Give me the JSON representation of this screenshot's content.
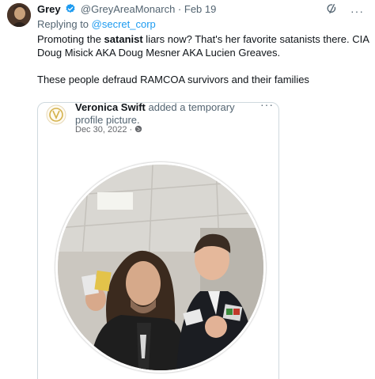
{
  "tweet": {
    "author": {
      "display_name": "Grey",
      "handle": "@GreyAreaMonarch",
      "separator": "·",
      "date": "Feb 19"
    },
    "reply": {
      "prefix": "Replying to ",
      "mention": "@secret_corp"
    },
    "body": {
      "line1_start": "Promoting the ",
      "line1_bold": "satanist",
      "line1_end": " liars now? That's her favorite satanists there. CIA Doug Misick AKA Doug Mesner AKA Lucien Greaves.",
      "paragraph2": "These people defraud RAMCOA survivors and their families"
    },
    "icons": {
      "verified": "verified-badge-icon",
      "grok": "grok-icon",
      "more": "more-icon"
    },
    "more_label": "···"
  },
  "quoted_post": {
    "name": "Veronica Swift",
    "action": " added a temporary profile picture.",
    "date": "Dec 30, 2022",
    "date_separator": "·",
    "more_label": "···",
    "privacy_icon": "globe-icon"
  },
  "colors": {
    "accent": "#1d9bf0",
    "text_primary": "#0f1419",
    "text_secondary": "#536471",
    "border": "#cfd9de"
  }
}
